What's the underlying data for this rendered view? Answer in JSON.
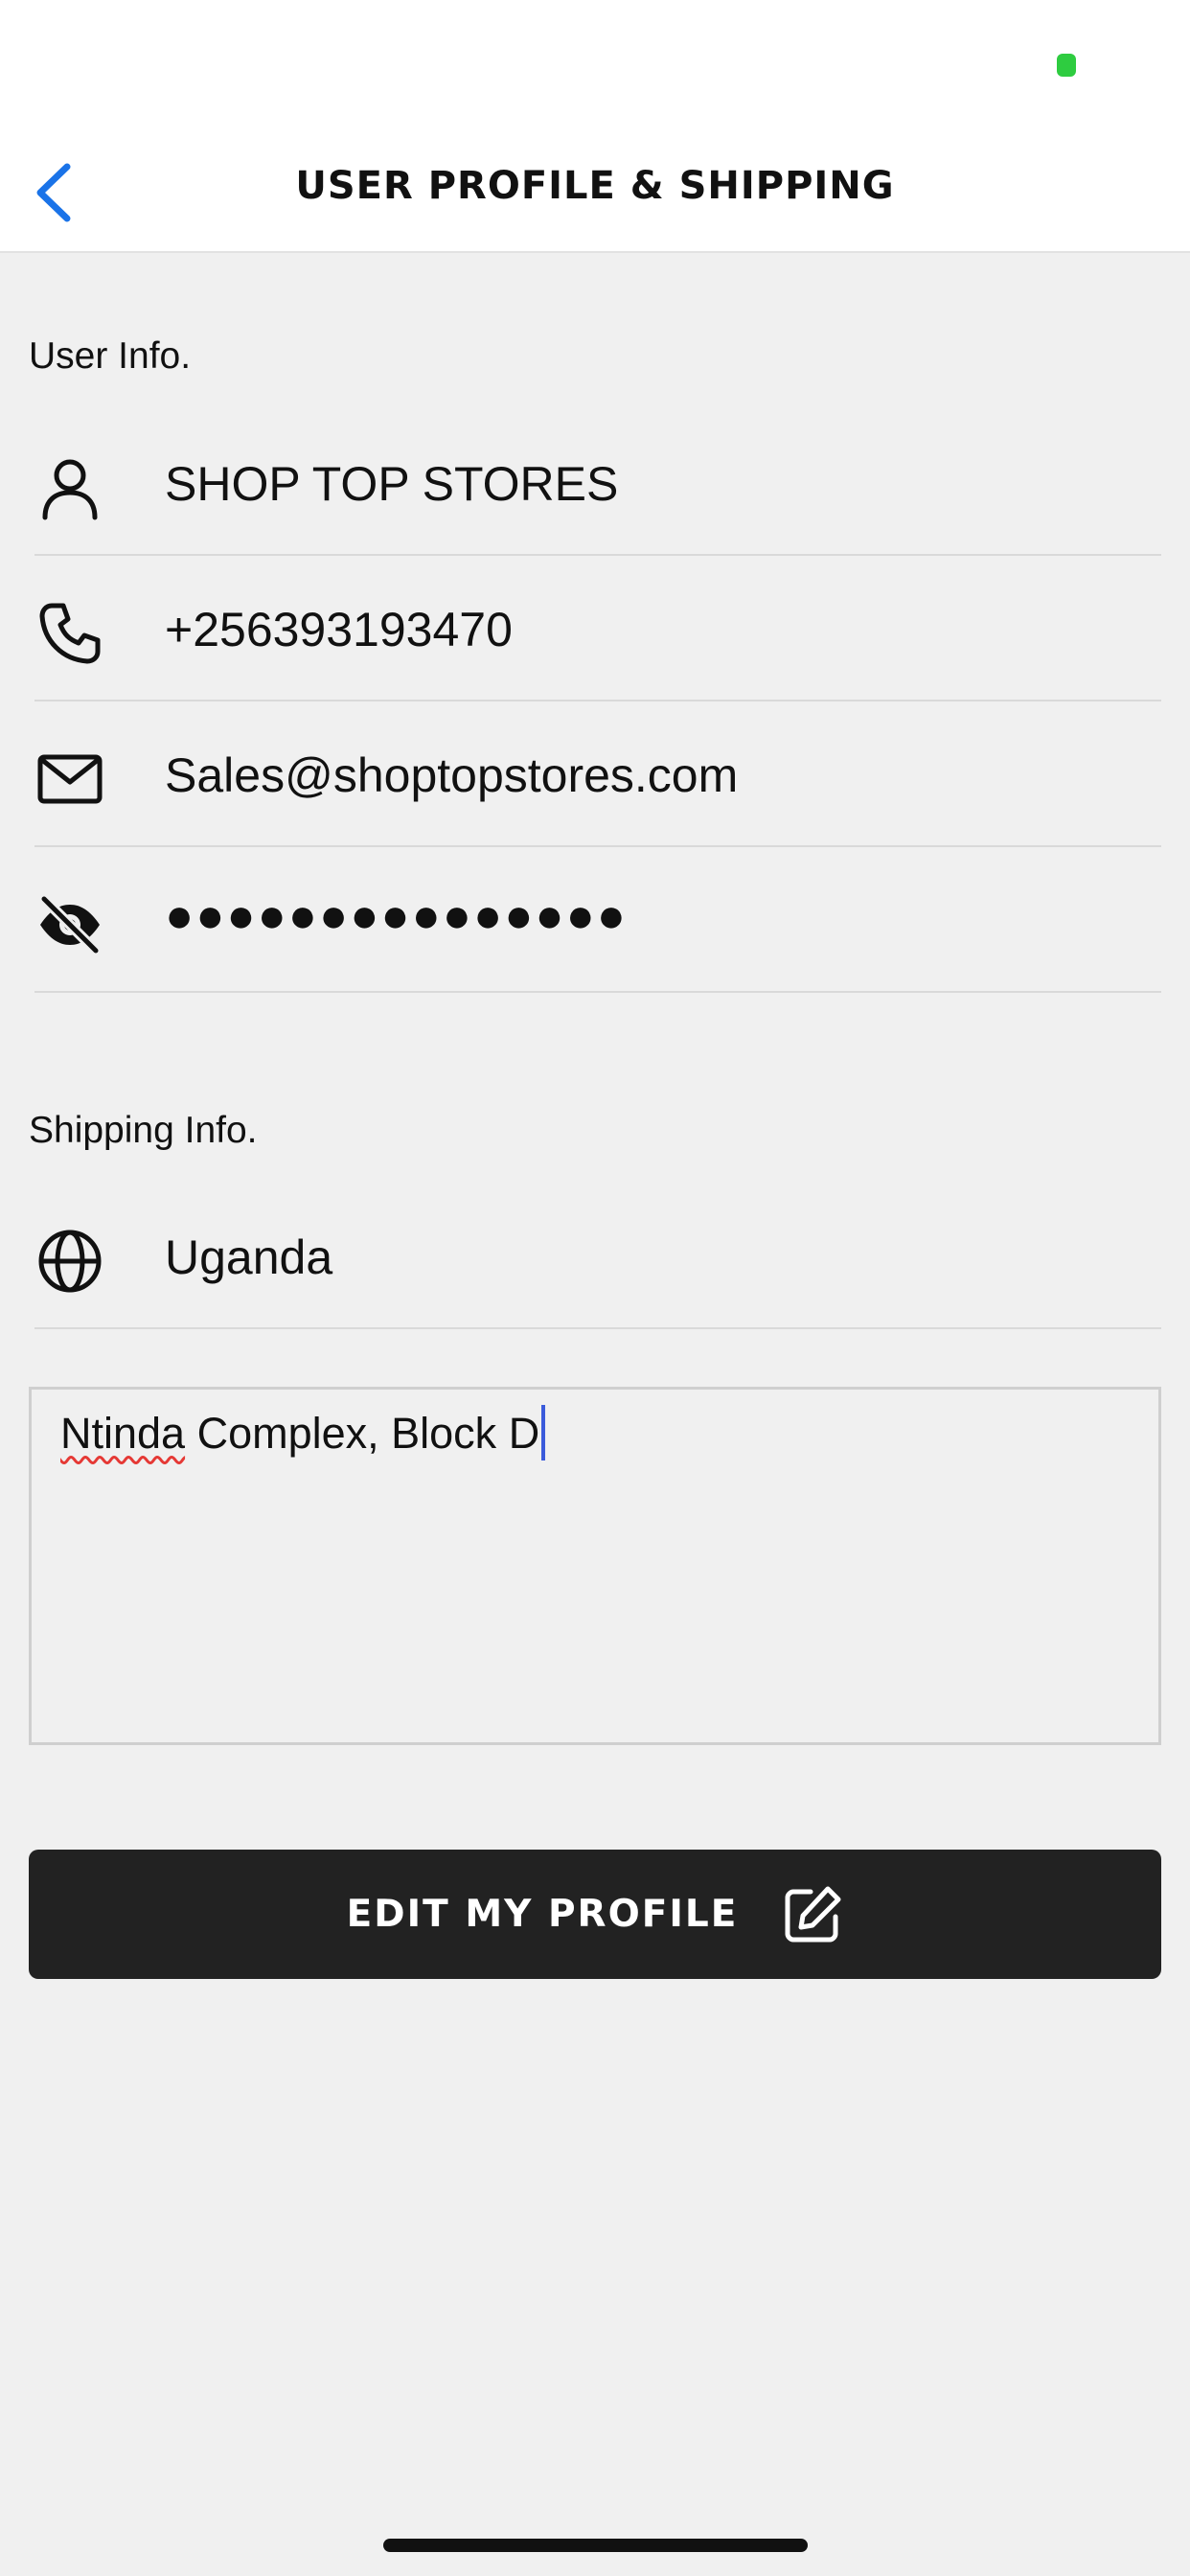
{
  "colors": {
    "accent": "#1a73e8",
    "status_dot": "#2ecc40",
    "button_bg": "#222222",
    "background": "#f0f0f0",
    "caret": "#3b5bdb",
    "spellcheck": "#e53935"
  },
  "nav": {
    "back_icon": "chevron-left-icon",
    "title": "USER PROFILE & SHIPPING"
  },
  "user_info": {
    "label": "User Info.",
    "name": {
      "icon": "person-icon",
      "value": "SHOP TOP STORES"
    },
    "phone": {
      "icon": "phone-icon",
      "value": "+256393193470"
    },
    "email": {
      "icon": "mail-icon",
      "value": "Sales@shoptopstores.com"
    },
    "password": {
      "icon": "eye-off-icon",
      "value": "●●●●●●●●●●●●●●●"
    }
  },
  "shipping_info": {
    "label": "Shipping Info.",
    "country": {
      "icon": "globe-icon",
      "value": "Uganda"
    },
    "address": {
      "misspelled_word": "Ntinda",
      "rest": " Complex, Block D"
    }
  },
  "edit_button": {
    "label": "EDIT MY PROFILE",
    "icon": "edit-icon"
  }
}
